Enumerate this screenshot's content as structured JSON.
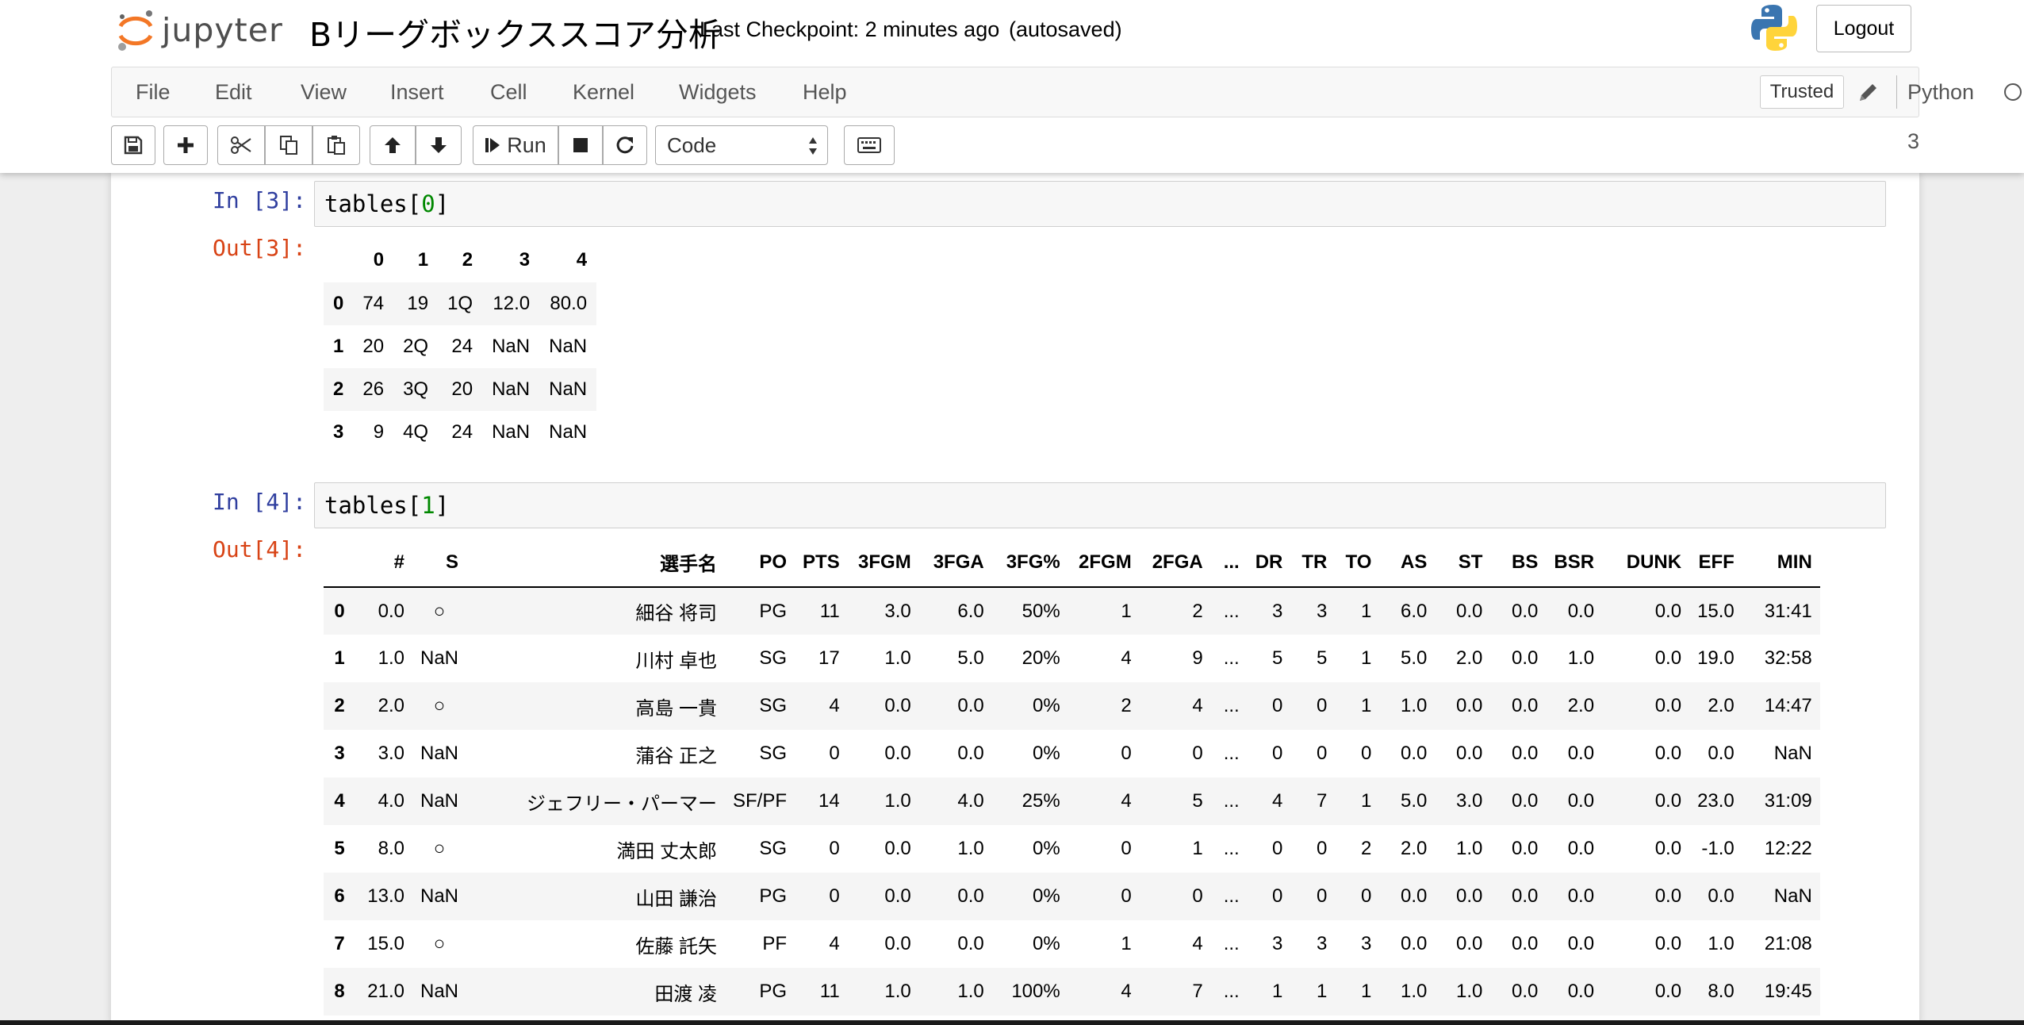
{
  "header": {
    "logo_text": "jupyter",
    "notebook_name": "Bリーグボックススコア分析",
    "checkpoint": "Last Checkpoint: 2 minutes ago",
    "autosave": "(autosaved)",
    "logout_label": "Logout",
    "accent_color": "#f37726"
  },
  "menubar": {
    "items": [
      "File",
      "Edit",
      "View",
      "Insert",
      "Cell",
      "Kernel",
      "Widgets",
      "Help"
    ],
    "trusted_label": "Trusted",
    "kernel_name": "Python 3"
  },
  "toolbar": {
    "buttons": [
      "save-icon",
      "plus-icon",
      "scissors-icon",
      "copy-icon",
      "paste-icon",
      "arrow-up-icon",
      "arrow-down-icon",
      "step-forward-icon",
      "stop-icon",
      "restart-icon",
      "keyboard-icon"
    ],
    "run_label": "Run",
    "cell_type": "Code"
  },
  "cells": [
    {
      "in_prompt": "In [3]:",
      "code_prefix": "tables[",
      "code_num": "0",
      "code_suffix": "]",
      "out_prompt": "Out[3]:",
      "table": {
        "columns": [
          "",
          "0",
          "1",
          "2",
          "3",
          "4"
        ],
        "rows": [
          [
            "0",
            "74",
            "19",
            "1Q",
            "12.0",
            "80.0"
          ],
          [
            "1",
            "20",
            "2Q",
            "24",
            "NaN",
            "NaN"
          ],
          [
            "2",
            "26",
            "3Q",
            "20",
            "NaN",
            "NaN"
          ],
          [
            "3",
            "9",
            "4Q",
            "24",
            "NaN",
            "NaN"
          ]
        ]
      }
    },
    {
      "in_prompt": "In [4]:",
      "code_prefix": "tables[",
      "code_num": "1",
      "code_suffix": "]",
      "out_prompt": "Out[4]:",
      "table": {
        "columns": [
          "",
          "#",
          "S",
          "選手名",
          "PO",
          "PTS",
          "3FGM",
          "3FGA",
          "3FG%",
          "2FGM",
          "2FGA",
          "...",
          "DR",
          "TR",
          "TO",
          "AS",
          "ST",
          "BS",
          "BSR",
          "DUNK",
          "EFF",
          "MIN"
        ],
        "rows": [
          [
            "0",
            "0.0",
            "○",
            "細谷 将司",
            "PG",
            "11",
            "3.0",
            "6.0",
            "50%",
            "1",
            "2",
            "...",
            "3",
            "3",
            "1",
            "6.0",
            "0.0",
            "0.0",
            "0.0",
            "0.0",
            "15.0",
            "31:41"
          ],
          [
            "1",
            "1.0",
            "NaN",
            "川村 卓也",
            "SG",
            "17",
            "1.0",
            "5.0",
            "20%",
            "4",
            "9",
            "...",
            "5",
            "5",
            "1",
            "5.0",
            "2.0",
            "0.0",
            "1.0",
            "0.0",
            "19.0",
            "32:58"
          ],
          [
            "2",
            "2.0",
            "○",
            "高島 一貴",
            "SG",
            "4",
            "0.0",
            "0.0",
            "0%",
            "2",
            "4",
            "...",
            "0",
            "0",
            "1",
            "1.0",
            "0.0",
            "0.0",
            "2.0",
            "0.0",
            "2.0",
            "14:47"
          ],
          [
            "3",
            "3.0",
            "NaN",
            "蒲谷 正之",
            "SG",
            "0",
            "0.0",
            "0.0",
            "0%",
            "0",
            "0",
            "...",
            "0",
            "0",
            "0",
            "0.0",
            "0.0",
            "0.0",
            "0.0",
            "0.0",
            "0.0",
            "NaN"
          ],
          [
            "4",
            "4.0",
            "NaN",
            "ジェフリー・パーマー",
            "SF/PF",
            "14",
            "1.0",
            "4.0",
            "25%",
            "4",
            "5",
            "...",
            "4",
            "7",
            "1",
            "5.0",
            "3.0",
            "0.0",
            "0.0",
            "0.0",
            "23.0",
            "31:09"
          ],
          [
            "5",
            "8.0",
            "○",
            "満田 丈太郎",
            "SG",
            "0",
            "0.0",
            "1.0",
            "0%",
            "0",
            "1",
            "...",
            "0",
            "0",
            "2",
            "2.0",
            "1.0",
            "0.0",
            "0.0",
            "0.0",
            "-1.0",
            "12:22"
          ],
          [
            "6",
            "13.0",
            "NaN",
            "山田 謙治",
            "PG",
            "0",
            "0.0",
            "0.0",
            "0%",
            "0",
            "0",
            "...",
            "0",
            "0",
            "0",
            "0.0",
            "0.0",
            "0.0",
            "0.0",
            "0.0",
            "0.0",
            "NaN"
          ],
          [
            "7",
            "15.0",
            "○",
            "佐藤 託矢",
            "PF",
            "4",
            "0.0",
            "0.0",
            "0%",
            "1",
            "4",
            "...",
            "3",
            "3",
            "3",
            "0.0",
            "0.0",
            "0.0",
            "0.0",
            "0.0",
            "1.0",
            "21:08"
          ],
          [
            "8",
            "21.0",
            "NaN",
            "田渡 凌",
            "PG",
            "11",
            "1.0",
            "1.0",
            "100%",
            "4",
            "7",
            "...",
            "1",
            "1",
            "1",
            "1.0",
            "1.0",
            "0.0",
            "0.0",
            "0.0",
            "8.0",
            "19:45"
          ]
        ]
      }
    }
  ]
}
